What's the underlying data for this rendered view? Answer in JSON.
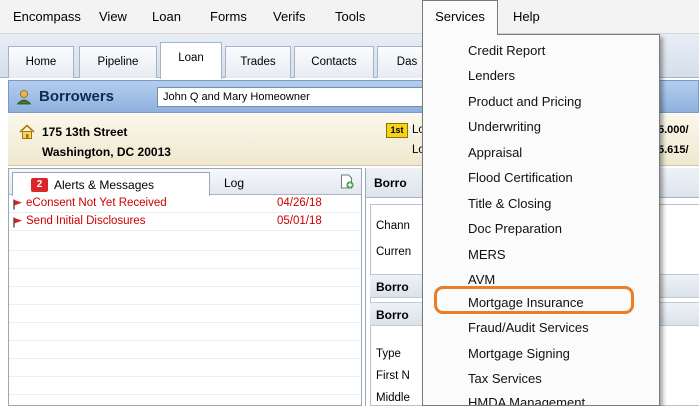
{
  "menubar": {
    "items": [
      "Encompass",
      "View",
      "Loan",
      "Forms",
      "Verifs",
      "Tools",
      "Services",
      "Help"
    ],
    "open_item": "Services"
  },
  "tabs": [
    "Home",
    "Pipeline",
    "Loan",
    "Trades",
    "Contacts",
    "Das"
  ],
  "active_tab": "Loan",
  "borrowers": {
    "title": "Borrowers",
    "selected": "John Q and Mary Homeowner"
  },
  "address": {
    "line1": "175 13th Street",
    "line2": "Washington, DC 20013",
    "lien_badge": "1st",
    "loan_label_1": "Loar",
    "loan_label_2": "Loar",
    "loan_value_1": "5.000/",
    "loan_value_2": "5.615/"
  },
  "alerts_panel": {
    "tab_label": "Alerts & Messages",
    "count": "2",
    "log_label": "Log",
    "rows": [
      {
        "text": "eConsent Not Yet Received",
        "date": "04/26/18"
      },
      {
        "text": "Send Initial Disclosures",
        "date": "05/01/18"
      }
    ]
  },
  "right_panel": {
    "header": "Borro",
    "channel_label": "Chann",
    "current_label": "Curren",
    "section1": "Borro",
    "section2": "Borro",
    "type_label": "Type",
    "first_name_label": "First N",
    "middle_label": "Middle"
  },
  "services_menu": {
    "items": [
      "Credit Report",
      "Lenders",
      "Product and Pricing",
      "Underwriting",
      "Appraisal",
      "Flood Certification",
      "Title & Closing",
      "Doc Preparation",
      "MERS",
      "AVM",
      "Mortgage Insurance",
      "Fraud/Audit Services",
      "Mortgage Signing",
      "Tax Services",
      "HMDA Management"
    ],
    "highlighted": "Mortgage Insurance"
  },
  "colors": {
    "highlight_ring": "#ea7d25",
    "alert_text": "#cc0000",
    "borrowers_bar": "#a3c1e8"
  }
}
